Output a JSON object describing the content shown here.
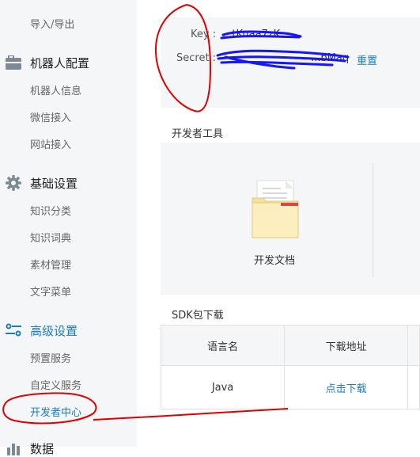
{
  "sidebar": {
    "top_item": "导入/导出",
    "groups": [
      {
        "label": "机器人配置",
        "icon": "briefcase-icon",
        "items": [
          "机器人信息",
          "微信接入",
          "网站接入"
        ]
      },
      {
        "label": "基础设置",
        "icon": "gear-icon",
        "items": [
          "知识分类",
          "知识词典",
          "素材管理",
          "文字菜单"
        ]
      },
      {
        "label": "高级设置",
        "icon": "sliders-icon",
        "items": [
          "预置服务",
          "自定义服务",
          "开发者中心"
        ]
      }
    ],
    "bottom_partial": "数据"
  },
  "credentials": {
    "key_label": "Key :",
    "key_value": "...tKuaa7zK",
    "secret_label": "Secret :",
    "secret_value": "...bMaq",
    "reset_label": "重置"
  },
  "dev_tools": {
    "title": "开发者工具",
    "doc_label": "开发文档"
  },
  "sdk": {
    "title": "SDK包下载",
    "columns": [
      "语言名",
      "下载地址"
    ],
    "rows": [
      {
        "lang": "Java",
        "link": "点击下载"
      }
    ]
  },
  "colors": {
    "accent": "#1a7cc3",
    "annotation": "#e00000",
    "scribble": "#1515ff"
  }
}
